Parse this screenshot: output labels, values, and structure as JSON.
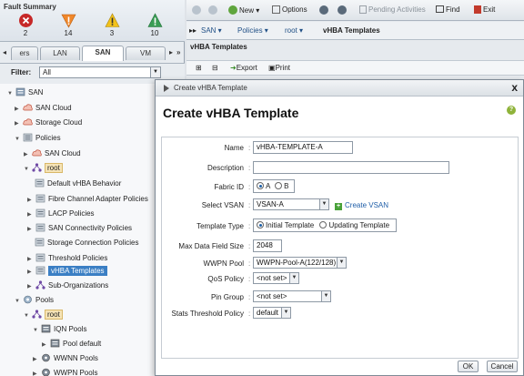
{
  "fault_summary": {
    "title": "Fault Summary",
    "items": [
      {
        "icon": "critical-icon",
        "count": "2",
        "color": "#c62828"
      },
      {
        "icon": "major-icon",
        "count": "14",
        "color": "#f0872a"
      },
      {
        "icon": "minor-icon",
        "count": "3",
        "color": "#f2c21b"
      },
      {
        "icon": "warning-icon",
        "count": "10",
        "color": "#3a9e55"
      }
    ]
  },
  "nav_tabs": {
    "items": [
      "ers",
      "LAN",
      "SAN",
      "VM"
    ],
    "active": "SAN",
    "more": "»"
  },
  "filter": {
    "label": "Filter:",
    "value": "All"
  },
  "tree": [
    {
      "label": "SAN"
    },
    {
      "label": "SAN Cloud"
    },
    {
      "label": "Storage Cloud"
    },
    {
      "label": "Policies"
    },
    {
      "label": "SAN Cloud"
    },
    {
      "label": "root"
    },
    {
      "label": "Default vHBA Behavior"
    },
    {
      "label": "Fibre Channel Adapter Policies"
    },
    {
      "label": "LACP Policies"
    },
    {
      "label": "SAN Connectivity Policies"
    },
    {
      "label": "Storage Connection Policies"
    },
    {
      "label": "Threshold Policies"
    },
    {
      "label": "vHBA Templates"
    },
    {
      "label": "Sub-Organizations"
    },
    {
      "label": "Pools"
    },
    {
      "label": "root"
    },
    {
      "label": "IQN Pools"
    },
    {
      "label": "Pool default"
    },
    {
      "label": "WWNN Pools"
    },
    {
      "label": "WWPN Pools"
    }
  ],
  "toolbar": {
    "new": "New",
    "options": "Options",
    "pending": "Pending Activities",
    "find": "Find",
    "exit": "Exit"
  },
  "breadcrumb": {
    "items": [
      "SAN",
      "Policies",
      "root",
      "vHBA Templates"
    ]
  },
  "content": {
    "heading": "vHBA Templates",
    "export": "Export",
    "print": "Print"
  },
  "dialog": {
    "window_title": "Create vHBA Template",
    "close": "x",
    "heading": "Create vHBA Template",
    "help": "?",
    "fields": {
      "name": {
        "label": "Name",
        "value": "vHBA-TEMPLATE-A"
      },
      "description": {
        "label": "Description",
        "value": ""
      },
      "fabric_id": {
        "label": "Fabric ID",
        "options": [
          "A",
          "B"
        ],
        "selected": "A"
      },
      "select_vsan": {
        "label": "Select VSAN",
        "value": "VSAN-A",
        "create_link": "Create VSAN"
      },
      "template_type": {
        "label": "Template Type",
        "options": [
          "Initial Template",
          "Updating Template"
        ],
        "selected": "Initial Template"
      },
      "max_data": {
        "label": "Max Data Field Size",
        "value": "2048"
      },
      "wwpn_pool": {
        "label": "WWPN Pool",
        "value": "WWPN-Pool-A(122/128)"
      },
      "qos": {
        "label": "QoS Policy",
        "value": "<not set>"
      },
      "pin_group": {
        "label": "Pin Group",
        "value": "<not set>"
      },
      "stats": {
        "label": "Stats Threshold Policy",
        "value": "default"
      }
    },
    "ok": "OK",
    "cancel": "Cancel"
  }
}
